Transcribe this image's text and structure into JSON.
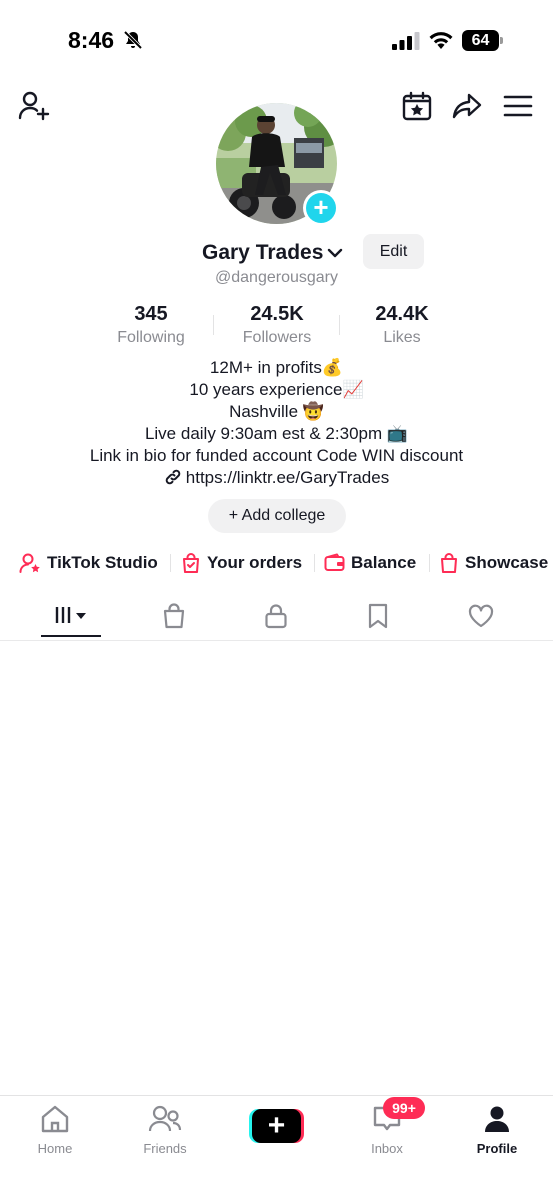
{
  "status_bar": {
    "time": "8:46",
    "battery": "64"
  },
  "profile": {
    "display_name": "Gary Trades",
    "edit_label": "Edit",
    "handle": "@dangerousgary"
  },
  "stats": [
    {
      "value": "345",
      "label": "Following"
    },
    {
      "value": "24.5K",
      "label": "Followers"
    },
    {
      "value": "24.4K",
      "label": "Likes"
    }
  ],
  "bio": {
    "lines": [
      "12M+ in profits💰",
      "10 years experience📈",
      "Nashville 🤠",
      "Live daily 9:30am est & 2:30pm  📺",
      "Link in bio for funded account Code WIN discount"
    ],
    "link": "https://linktr.ee/GaryTrades"
  },
  "add_college_label": "+ Add college",
  "tools": [
    {
      "label": "TikTok Studio",
      "icon": "person-star-icon"
    },
    {
      "label": "Your orders",
      "icon": "order-bag-icon"
    },
    {
      "label": "Balance",
      "icon": "wallet-icon"
    },
    {
      "label": "Showcase",
      "icon": "shopping-bag-icon"
    }
  ],
  "tabs": [
    {
      "name": "videos",
      "icon": "grid-lines-icon",
      "active": true
    },
    {
      "name": "shop",
      "icon": "shopping-bag-icon"
    },
    {
      "name": "private",
      "icon": "lock-icon"
    },
    {
      "name": "favorites",
      "icon": "bookmark-icon"
    },
    {
      "name": "liked",
      "icon": "heart-icon"
    }
  ],
  "bottom_nav": {
    "home": "Home",
    "friends": "Friends",
    "inbox": "Inbox",
    "inbox_badge": "99+",
    "profile": "Profile"
  },
  "colors": {
    "accent_pink": "#fe2c55",
    "accent_cyan": "#20d5ec",
    "text_primary": "#161823",
    "text_secondary": "#8a8b91"
  }
}
